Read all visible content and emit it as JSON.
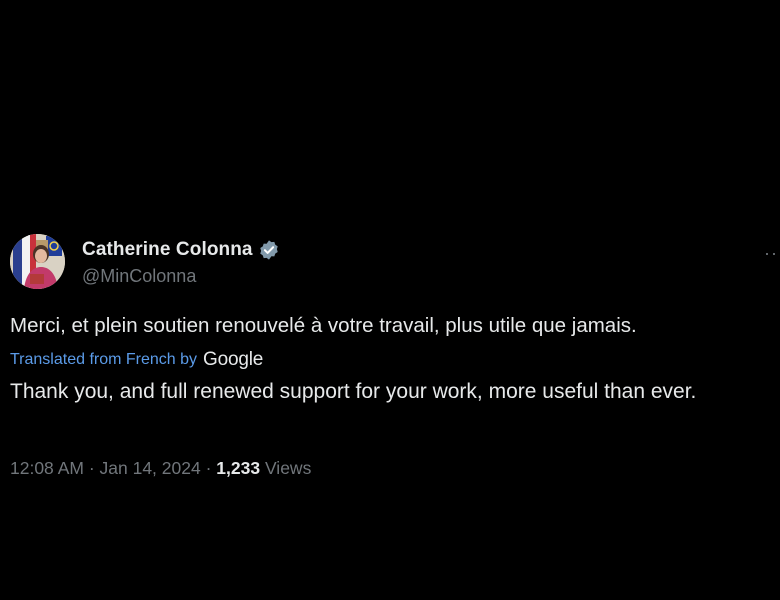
{
  "tweet": {
    "author": {
      "display_name": "Catherine Colonna",
      "handle": "@MinColonna",
      "verified_icon": "verified-badge-icon",
      "verified_color": "#829aab"
    },
    "more_icon": "more-options-icon",
    "text": "Merci, et plein soutien renouvelé à votre travail, plus utile que jamais.",
    "translation": {
      "label": "Translated from French by",
      "provider": "Google",
      "text": "Thank you, and full renewed support for your work, more useful than ever."
    },
    "meta": {
      "time": "12:08 AM",
      "separator": " · ",
      "date": "Jan 14, 2024",
      "views_count": "1,233",
      "views_label": "Views"
    }
  },
  "colors": {
    "background": "#000000",
    "primary_text": "#e7e9ea",
    "secondary_text": "#71767b",
    "link": "#5b9be8"
  }
}
